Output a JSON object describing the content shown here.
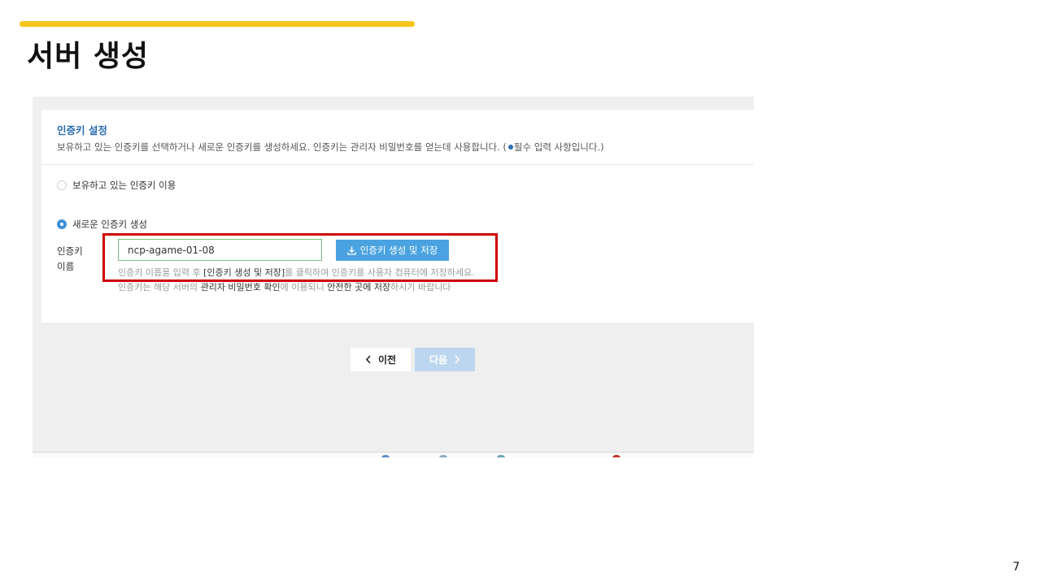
{
  "slide": {
    "title": "서버 생성",
    "page_number": "7",
    "accent_color": "#f5c518"
  },
  "panel": {
    "title": "인증키 설정",
    "description_part1": "보유하고 있는 인증키를 선택하거나 새로운 인증키를 생성하세요. 인증키는 관리자 비밀번호를 얻는데 사용합니다. (",
    "description_part2": "필수 입력 사항입니다.)"
  },
  "options": {
    "existing_key_label": "보유하고 있는 인증키 이용",
    "new_key_label": "새로운 인증키 생성",
    "selected": "new_key"
  },
  "key_form": {
    "field_label": "인증키 이름",
    "input_value": "ncp-agame-01-08",
    "generate_button_label": "인증키 생성 및 저장",
    "help1_part1": "인증키 이름을 입력 후 ",
    "help1_em": "[인증키 생성 및 저장]",
    "help1_part2": "를 클릭하여 인증키를 사용자 컴퓨터에 저장하세요.",
    "help2_part1": "인증키는 해당 서버의 ",
    "help2_em1": "관리자 비밀번호 확인",
    "help2_part2": "에 이용되니 ",
    "help2_em2": "안전한 곳에 저장",
    "help2_part3": "하시기 바랍니다"
  },
  "navigation": {
    "prev_label": "이전",
    "next_label": "다음"
  },
  "colors": {
    "primary_blue": "#4aa3e0",
    "title_blue": "#2a6db0",
    "highlight_red": "#d00000",
    "input_border_green": "#78c27a"
  }
}
